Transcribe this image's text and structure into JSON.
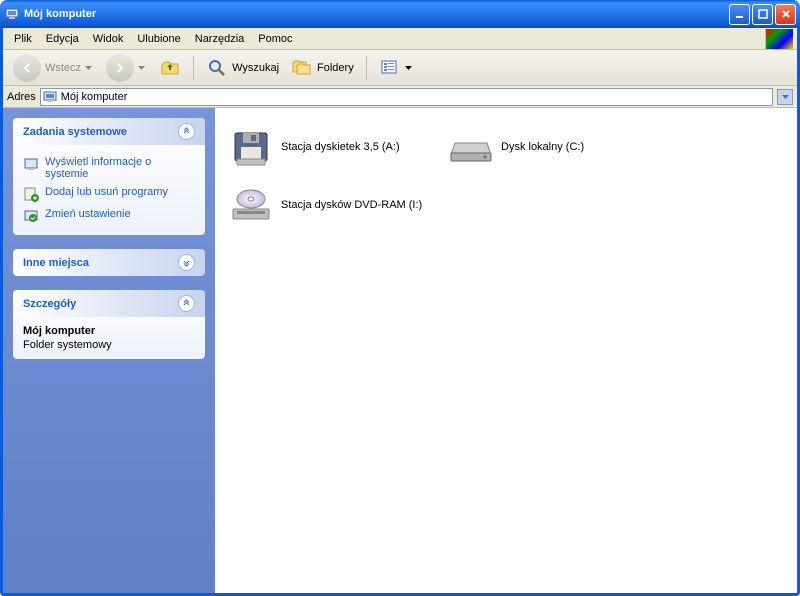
{
  "window": {
    "title": "Mój komputer"
  },
  "menu": {
    "items": [
      "Plik",
      "Edycja",
      "Widok",
      "Ulubione",
      "Narzędzia",
      "Pomoc"
    ]
  },
  "toolbar": {
    "back": "Wstecz",
    "search": "Wyszukaj",
    "folders": "Foldery"
  },
  "address": {
    "label": "Adres",
    "value": "Mój komputer"
  },
  "sidebar": {
    "tasks": {
      "title": "Zadania systemowe",
      "items": [
        "Wyświetl informacje o systemie",
        "Dodaj lub usuń programy",
        "Zmień ustawienie"
      ]
    },
    "other": {
      "title": "Inne miejsca"
    },
    "details": {
      "title": "Szczegóły",
      "name": "Mój komputer",
      "type": "Folder systemowy"
    }
  },
  "drives": [
    {
      "label": "Stacja dyskietek 3,5 (A:)",
      "icon": "floppy"
    },
    {
      "label": "Dysk lokalny (C:)",
      "icon": "hdd"
    },
    {
      "label": "Stacja dysków DVD-RAM (I:)",
      "icon": "optical"
    }
  ]
}
